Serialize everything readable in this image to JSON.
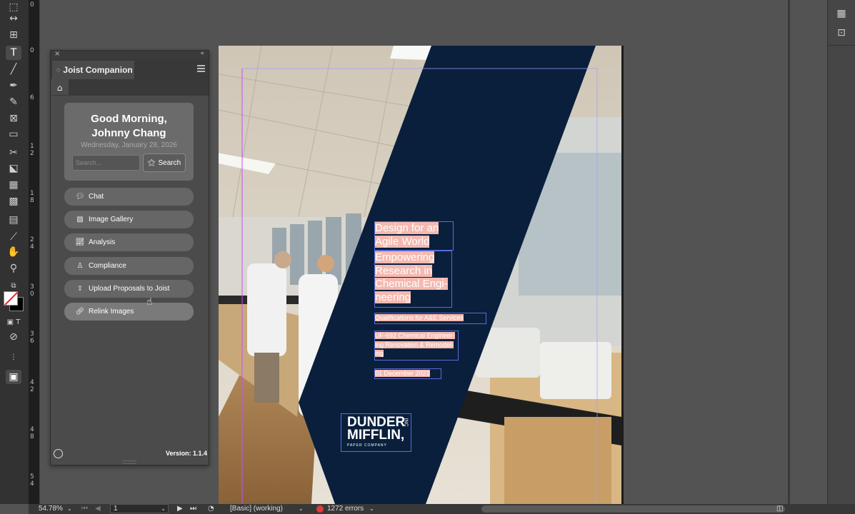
{
  "ruler": {
    "numbers": [
      "0",
      "6",
      "1\n2",
      "1\n8",
      "2\n4",
      "3\n0",
      "3\n6",
      "4\n2",
      "4\n8",
      "5\n4"
    ]
  },
  "tools": [
    "selection-arrow",
    "gap-tool",
    "content-collector",
    "type-tool",
    "line-tool",
    "pen-tool",
    "pencil-tool",
    "rectangle-frame-tool",
    "rectangle-tool",
    "scissors-tool",
    "free-transform-tool",
    "gradient-swatch-tool",
    "gradient-feather-tool",
    "note-tool",
    "eyedropper-tool",
    "hand-tool",
    "zoom-tool"
  ],
  "panel": {
    "title": "Joist Companion",
    "greeting_line1": "Good Morning,",
    "greeting_line2": "Johnny Chang",
    "date": "Wednesday, January 28, 2026",
    "search_placeholder": "Search...",
    "search_button": "Search",
    "menu": [
      {
        "label": "Chat",
        "icon": "chat-icon"
      },
      {
        "label": "Image Gallery",
        "icon": "image-gallery-icon"
      },
      {
        "label": "Analysis",
        "icon": "analysis-icon"
      },
      {
        "label": "Compliance",
        "icon": "compliance-icon"
      },
      {
        "label": "Upload Proposals to Joist",
        "icon": "upload-icon"
      },
      {
        "label": "Relink Images",
        "icon": "link-icon"
      }
    ],
    "version": "Version: 1.1.4"
  },
  "document": {
    "title_line1": "Design for an",
    "title_line2": "Agile World",
    "subtitle_lines": [
      "Empowering",
      "Research in",
      "Chemical Engi-",
      "neering"
    ],
    "qualifications": "Qualifications for A&E Services",
    "project_lines": [
      "UF-692 Chemical Engineer-",
      "ing Renovation & Remodel-",
      "ing"
    ],
    "date": "01 December 2023",
    "logo_line1": "DUNDER",
    "logo_line2": "MIFFLIN,",
    "logo_inc": "INC",
    "logo_tag": "PAPER COMPANY"
  },
  "status": {
    "zoom": "54.78%",
    "page": "1",
    "preflight_profile": "[Basic] (working)",
    "errors": "1272 errors"
  },
  "colors": {
    "navy_panel": "#0a1f3c",
    "highlight": "#f4b9b0",
    "error": "#e23b3b"
  }
}
